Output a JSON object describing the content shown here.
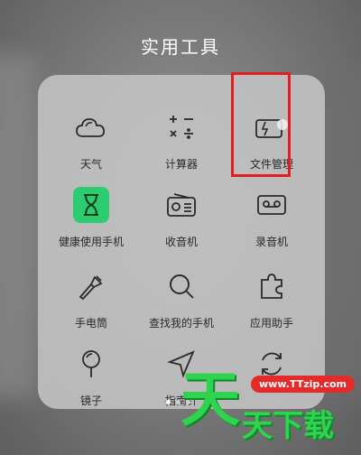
{
  "screen": {
    "title": "实用工具"
  },
  "tools": [
    {
      "label": "天气",
      "icon": "weather-cloud-icon"
    },
    {
      "label": "计算器",
      "icon": "calculator-icon"
    },
    {
      "label": "文件管理",
      "icon": "file-manager-icon"
    },
    {
      "label": "健康使用手机",
      "icon": "hourglass-icon"
    },
    {
      "label": "收音机",
      "icon": "radio-icon"
    },
    {
      "label": "录音机",
      "icon": "recorder-icon"
    },
    {
      "label": "手电筒",
      "icon": "flashlight-icon"
    },
    {
      "label": "查找我的手机",
      "icon": "magnifier-icon"
    },
    {
      "label": "应用助手",
      "icon": "puzzle-icon"
    },
    {
      "label": "镜子",
      "icon": "mirror-icon"
    },
    {
      "label": "指南针",
      "icon": "compass-icon"
    },
    {
      "label": "",
      "icon": "refresh-icon"
    }
  ],
  "pager": {
    "total": 3,
    "active": 0
  },
  "watermark": {
    "url": "www.TTzip.com",
    "big": "天",
    "rest": "天下载"
  },
  "colors": {
    "highlight": "#e02020",
    "green": "#2ecc71",
    "watermark": "#2ed34e"
  }
}
